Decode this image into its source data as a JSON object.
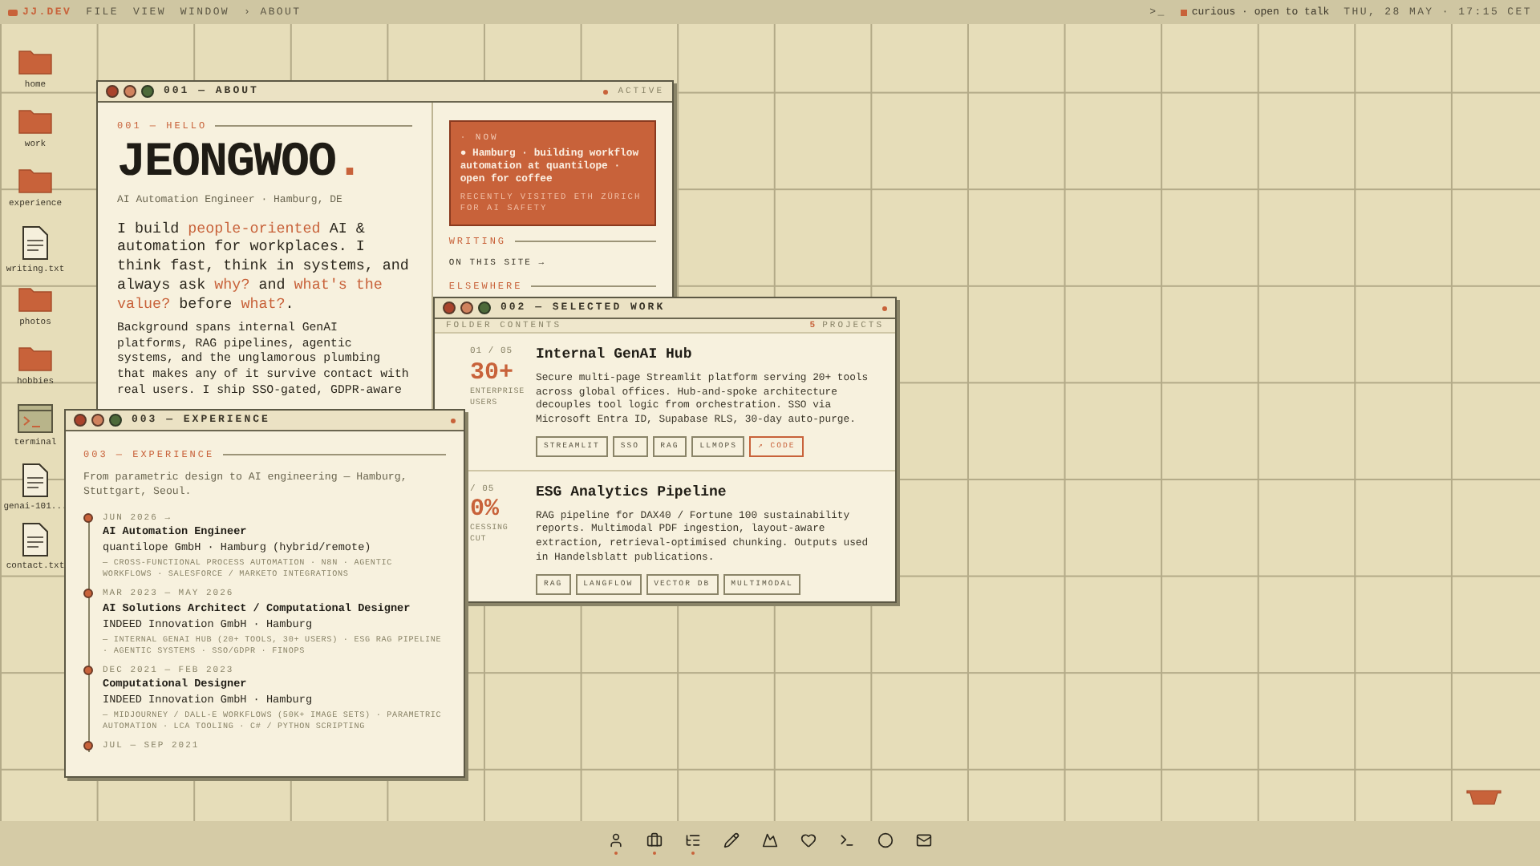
{
  "menubar": {
    "logo": "JJ.DEV",
    "menus": [
      "FILE",
      "VIEW",
      "WINDOW",
      "› ABOUT"
    ],
    "prompt": ">_",
    "status": "curious · open to talk",
    "datetime": "THU, 28 MAY · 17:15 CET"
  },
  "desktop_icons": [
    {
      "label": "home",
      "kind": "folder"
    },
    {
      "label": "work",
      "kind": "folder"
    },
    {
      "label": "experience",
      "kind": "folder"
    },
    {
      "label": "writing.txt",
      "kind": "file"
    },
    {
      "label": "photos",
      "kind": "folder"
    },
    {
      "label": "hobbies",
      "kind": "folder"
    },
    {
      "label": "terminal",
      "kind": "terminal"
    },
    {
      "label": "genai-101...",
      "kind": "file"
    },
    {
      "label": "contact.txt",
      "kind": "file"
    }
  ],
  "about_window": {
    "title": "001 — ABOUT",
    "status": "ACTIVE",
    "section": "001 — HELLO",
    "name": "JEONGWOO",
    "name_dot": ".",
    "role": "AI Automation Engineer · Hamburg, DE",
    "intro": "I build *people-oriented* AI & automation for workplaces. I think fast, think in systems, and always ask *why?* and *what's the value?* before *what?*.",
    "background": "Background spans internal GenAI platforms, RAG pipelines, agentic systems, and the unglamorous plumbing that makes any of it survive contact with real users. I ship SSO-gated, GDPR-aware",
    "now": {
      "label": "· NOW",
      "text": "● Hamburg · building workflow automation at quantilope · open for coffee",
      "note": "RECENTLY VISITED ETH ZÜRICH FOR AI SAFETY"
    },
    "writing_label": "WRITING",
    "writing_link": "ON THIS SITE →",
    "elsewhere_label": "ELSEWHERE"
  },
  "work_window": {
    "title": "002 — SELECTED WORK",
    "subheader": "FOLDER CONTENTS",
    "count": "5",
    "count_label": "PROJECTS",
    "projects": [
      {
        "index": "01 / 05",
        "stat": "30+",
        "stat_label": "ENTERPRISE USERS",
        "title": "Internal GenAI Hub",
        "description": "Secure multi-page Streamlit platform serving 20+ tools across global offices. Hub-and-spoke architecture decouples tool logic from orchestration. SSO via Microsoft Entra ID, Supabase RLS, 30-day auto-purge.",
        "tags": [
          {
            "label": "STREAMLIT",
            "kind": "tag"
          },
          {
            "label": "SSO",
            "kind": "tag"
          },
          {
            "label": "RAG",
            "kind": "tag"
          },
          {
            "label": "LLMOPS",
            "kind": "tag"
          },
          {
            "label": "↗ CODE",
            "kind": "link"
          }
        ]
      },
      {
        "index": "/ 05",
        "stat": "0%",
        "stat_label": "CESSING CUT",
        "title": "ESG Analytics Pipeline",
        "description": "RAG pipeline for DAX40 / Fortune 100 sustainability reports. Multimodal PDF ingestion, layout-aware extraction, retrieval-optimised chunking. Outputs used in Handelsblatt publications.",
        "tags": [
          {
            "label": "RAG",
            "kind": "tag"
          },
          {
            "label": "LANGFLOW",
            "kind": "tag"
          },
          {
            "label": "VECTOR DB",
            "kind": "tag"
          },
          {
            "label": "MULTIMODAL",
            "kind": "tag"
          }
        ]
      }
    ]
  },
  "experience_window": {
    "title": "003 — EXPERIENCE",
    "section": "003 — EXPERIENCE",
    "intro": "From parametric design to AI engineering — Hamburg, Stuttgart, Seoul.",
    "entries": [
      {
        "dates": "JUN 2026 →",
        "role": "AI Automation Engineer",
        "company": "quantilope GmbH · Hamburg (hybrid/remote)",
        "details": "— CROSS-FUNCTIONAL PROCESS AUTOMATION · N8N · AGENTIC WORKFLOWS · SALESFORCE / MARKETO INTEGRATIONS"
      },
      {
        "dates": "MAR 2023 — MAY 2026",
        "role": "AI Solutions Architect / Computational Designer",
        "company": "INDEED Innovation GmbH · Hamburg",
        "details": "— INTERNAL GENAI HUB (20+ TOOLS, 30+ USERS) · ESG RAG PIPELINE · AGENTIC SYSTEMS · SSO/GDPR · FINOPS"
      },
      {
        "dates": "DEC 2021 — FEB 2023",
        "role": "Computational Designer",
        "company": "INDEED Innovation GmbH · Hamburg",
        "details": "— MIDJOURNEY / DALL-E WORKFLOWS (50K+ IMAGE SETS) · PARAMETRIC AUTOMATION · LCA TOOLING · C# / PYTHON SCRIPTING"
      },
      {
        "dates": "JUL — SEP 2021"
      }
    ]
  },
  "dock": [
    {
      "kind": "user",
      "open": true
    },
    {
      "kind": "briefcase",
      "open": true
    },
    {
      "kind": "timeline",
      "open": true
    },
    {
      "kind": "pencil",
      "open": false
    },
    {
      "kind": "mountain",
      "open": false
    },
    {
      "kind": "heart",
      "open": false
    },
    {
      "kind": "terminal",
      "open": false
    },
    {
      "kind": "circle",
      "open": false
    },
    {
      "kind": "mail",
      "open": false
    }
  ]
}
